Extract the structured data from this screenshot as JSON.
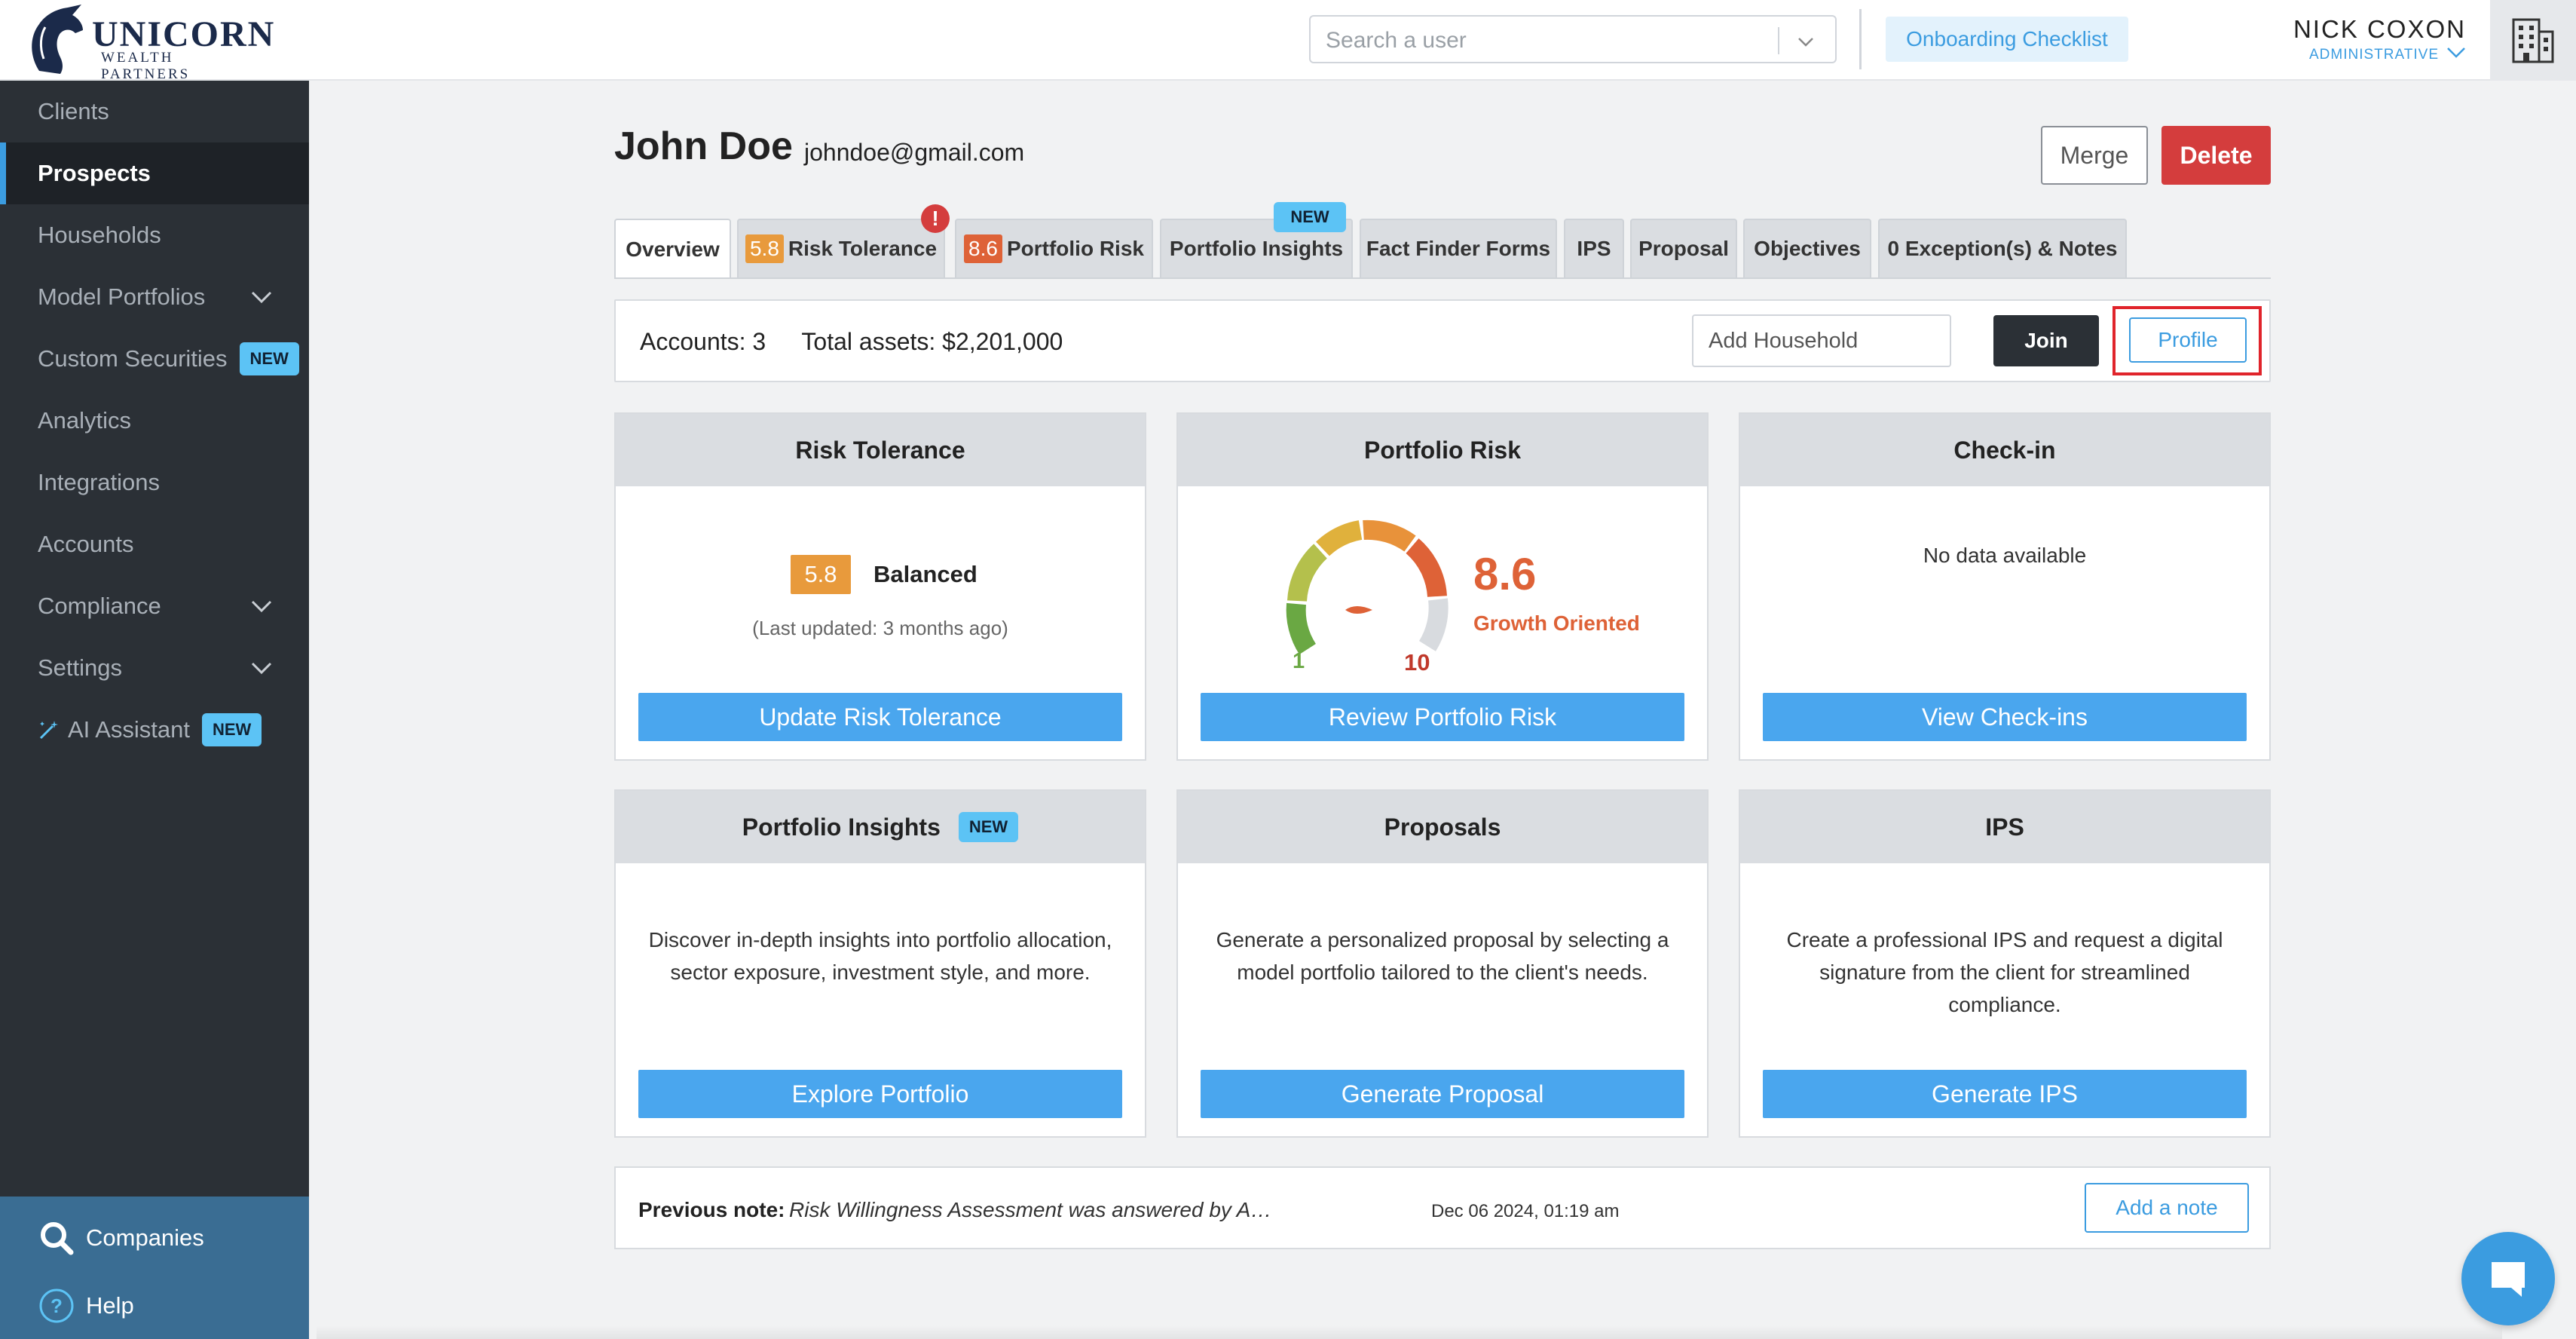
{
  "brand": {
    "name": "UNICORN",
    "sub": "WEALTH PARTNERS"
  },
  "topbar": {
    "search_placeholder": "Search a user",
    "onboarding_label": "Onboarding Checklist",
    "user_name": "NICK COXON",
    "user_role": "ADMINISTRATIVE"
  },
  "sidebar": {
    "items": [
      {
        "label": "Clients"
      },
      {
        "label": "Prospects"
      },
      {
        "label": "Households"
      },
      {
        "label": "Model Portfolios"
      },
      {
        "label": "Custom Securities",
        "badge": "NEW"
      },
      {
        "label": "Analytics"
      },
      {
        "label": "Integrations"
      },
      {
        "label": "Accounts"
      },
      {
        "label": "Compliance"
      },
      {
        "label": "Settings"
      },
      {
        "label": "AI Assistant",
        "badge": "NEW"
      }
    ],
    "bottom": [
      {
        "label": "Companies"
      },
      {
        "label": "Help"
      }
    ]
  },
  "profile": {
    "name": "John Doe",
    "email": "johndoe@gmail.com",
    "merge_label": "Merge",
    "delete_label": "Delete"
  },
  "tabs": [
    {
      "label": "Overview"
    },
    {
      "label": "Risk Tolerance",
      "score": "5.8",
      "alert": "!"
    },
    {
      "label": "Portfolio Risk",
      "score": "8.6"
    },
    {
      "label": "Portfolio Insights",
      "badge": "NEW"
    },
    {
      "label": "Fact Finder Forms"
    },
    {
      "label": "IPS"
    },
    {
      "label": "Proposal"
    },
    {
      "label": "Objectives"
    },
    {
      "label": "0 Exception(s) & Notes"
    }
  ],
  "accounts_bar": {
    "accounts_label": "Accounts:",
    "accounts_value": "3",
    "assets_label": "Total assets:",
    "assets_value": "$2,201,000",
    "household_placeholder": "Add Household",
    "join_label": "Join",
    "profile_label": "Profile"
  },
  "cards": {
    "risk_tolerance": {
      "title": "Risk Tolerance",
      "score": "5.8",
      "label": "Balanced",
      "updated": "(Last updated: 3 months ago)",
      "button": "Update Risk Tolerance"
    },
    "portfolio_risk": {
      "title": "Portfolio Risk",
      "score": "8.6",
      "label": "Growth Oriented",
      "gauge_min": "1",
      "gauge_max": "10",
      "gauge_value": 8.6,
      "button": "Review Portfolio Risk"
    },
    "checkin": {
      "title": "Check-in",
      "empty": "No data available",
      "button": "View Check-ins"
    },
    "insights": {
      "title": "Portfolio Insights",
      "badge": "NEW",
      "desc": "Discover in-depth insights into portfolio allocation, sector exposure, investment style, and more.",
      "button": "Explore Portfolio"
    },
    "proposals": {
      "title": "Proposals",
      "desc": "Generate a personalized proposal by selecting a model portfolio tailored to the client's needs.",
      "button": "Generate Proposal"
    },
    "ips": {
      "title": "IPS",
      "desc": "Create a professional IPS and request a digital signature from the client for streamlined compliance.",
      "button": "Generate IPS"
    }
  },
  "note": {
    "label": "Previous note:",
    "text": "Risk Willingness Assessment was answered by Akhil Lodha. The tole...",
    "date": "Dec 06 2024, 01:19 am",
    "add_label": "Add a note"
  },
  "colors": {
    "accent": "#3b9ce0",
    "button_blue": "#4aa6ee",
    "danger": "#d43d3d",
    "sidebar_bg": "#2b3036",
    "score_orange": "#e89a3c",
    "score_red_orange": "#de6237"
  }
}
